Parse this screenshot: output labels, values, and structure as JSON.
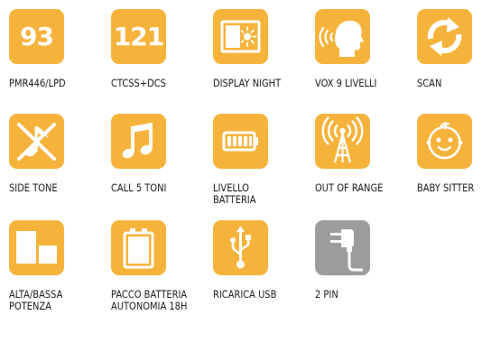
{
  "colors": {
    "tile": "#F6B33B",
    "tile_alt": "#9C9C9C",
    "icon": "#FFFFFF"
  },
  "features": [
    {
      "label": "PMR446/LPD",
      "tile_text": "93",
      "icon": "number-93-icon"
    },
    {
      "label": "CTCSS+DCS",
      "tile_text": "121",
      "icon": "number-121-icon"
    },
    {
      "label": "DISPLAY NIGHT",
      "icon": "moon-sun-display-icon"
    },
    {
      "label": "VOX 9 LIVELLI",
      "icon": "speaking-head-icon"
    },
    {
      "label": "SCAN",
      "icon": "refresh-arrows-icon"
    },
    {
      "label": "SIDE TONE",
      "icon": "muted-note-icon"
    },
    {
      "label": "CALL 5 TONI",
      "icon": "music-note-icon"
    },
    {
      "label": "LIVELLO\nBATTERIA",
      "icon": "battery-level-icon"
    },
    {
      "label": "OUT OF RANGE",
      "icon": "antenna-signal-icon"
    },
    {
      "label": "BABY SITTER",
      "icon": "baby-face-icon"
    },
    {
      "label": "ALTA/BASSA\nPOTENZA",
      "icon": "power-level-icon"
    },
    {
      "label": "PACCO BATTERIA\nAUTONOMIA 18H",
      "icon": "battery-pack-icon"
    },
    {
      "label": "RICARICA USB",
      "icon": "usb-icon"
    },
    {
      "label": "2 PIN",
      "icon": "charger-plug-icon"
    }
  ]
}
